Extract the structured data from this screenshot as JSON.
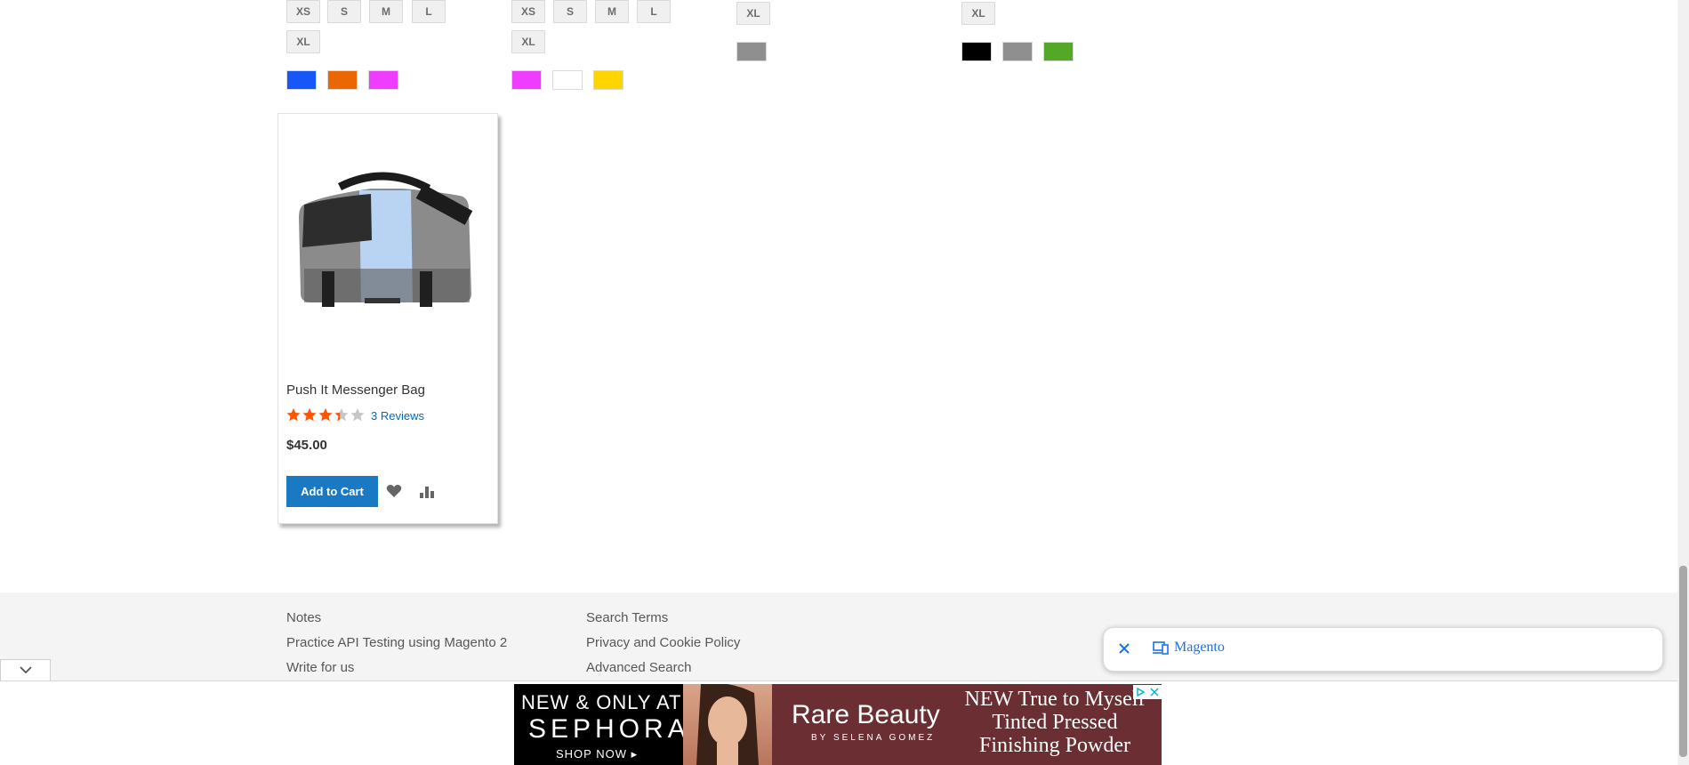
{
  "products_top": [
    {
      "sizes": [
        "XS",
        "S",
        "M",
        "L",
        "XL"
      ],
      "colors": [
        "#1857f7",
        "#eb6703",
        "#ef3dff"
      ]
    },
    {
      "sizes": [
        "XS",
        "S",
        "M",
        "L",
        "XL"
      ],
      "colors": [
        "#ef3dff",
        "#ffffff",
        "#ffd500"
      ]
    },
    {
      "sizes": [
        "XL"
      ],
      "colors": [
        "#8f8f8f"
      ]
    },
    {
      "sizes": [
        "XL"
      ],
      "colors": [
        "#000000",
        "#8f8f8f",
        "#53a828"
      ]
    }
  ],
  "product": {
    "name": "Push It Messenger Bag",
    "rating_percent": 67,
    "reviews": "3 Reviews",
    "price": "$45.00",
    "add_to_cart": "Add to Cart"
  },
  "footer": {
    "col1": [
      "Notes",
      "Practice API Testing using Magento 2",
      "Write for us"
    ],
    "col2": [
      "Search Terms",
      "Privacy and Cookie Policy",
      "Advanced Search"
    ]
  },
  "popup": {
    "label": "Magento"
  },
  "ad": {
    "line1": "NEW & ONLY AT",
    "line2": "SEPHORA",
    "line3": "SHOP NOW ▸",
    "brand": "Rare Beauty",
    "brand_sub": "BY SELENA GOMEZ",
    "headline": "NEW True to Myself Tinted Pressed Finishing Powder"
  },
  "colors": {
    "accent": "#1979c3",
    "star": "#ff5501",
    "link": "#006bb4"
  }
}
